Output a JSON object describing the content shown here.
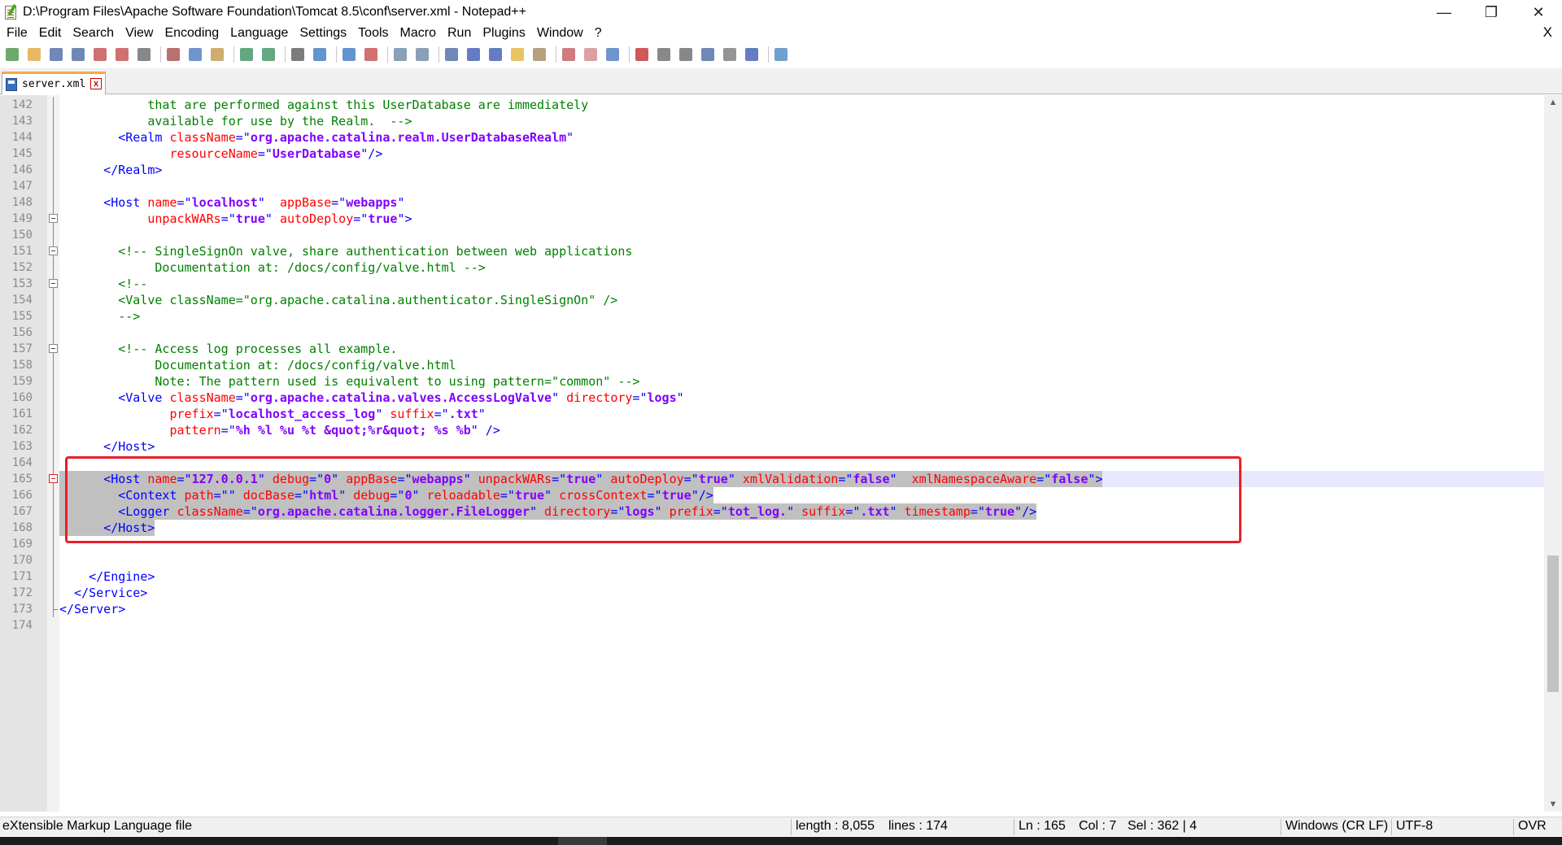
{
  "window": {
    "title": "D:\\Program Files\\Apache Software Foundation\\Tomcat 8.5\\conf\\server.xml - Notepad++",
    "minimize_glyph": "—",
    "restore_glyph": "❐",
    "close_glyph": "✕"
  },
  "menu": {
    "items": [
      "File",
      "Edit",
      "Search",
      "View",
      "Encoding",
      "Language",
      "Settings",
      "Tools",
      "Macro",
      "Run",
      "Plugins",
      "Window",
      "?"
    ],
    "close_glyph": "X"
  },
  "toolbar": {
    "icons": [
      "new-file-icon",
      "open-file-icon",
      "save-icon",
      "save-all-icon",
      "close-icon",
      "close-all-icon",
      "print-icon",
      "cut-icon",
      "copy-icon",
      "paste-icon",
      "undo-icon",
      "redo-icon",
      "find-icon",
      "replace-icon",
      "zoom-in-icon",
      "zoom-out-icon",
      "sync-vertical-icon",
      "sync-horizontal-icon",
      "word-wrap-icon",
      "show-all-chars-icon",
      "indent-guide-icon",
      "user-lang-icon",
      "doc-map-icon",
      "function-list-icon",
      "folder-workspace-icon",
      "monitoring-icon",
      "record-macro-icon",
      "stop-macro-icon",
      "play-macro-icon",
      "run-macro-multiple-icon",
      "save-macro-icon",
      "spell-check-icon",
      "spell-next-icon"
    ],
    "colors": [
      "#3c8c3c",
      "#e0a030",
      "#4060a0",
      "#4060a0",
      "#c04040",
      "#c04040",
      "#606060",
      "#a04040",
      "#4070c0",
      "#c09040",
      "#2e8b57",
      "#2e8b57",
      "#505050",
      "#3070c0",
      "#3070c0",
      "#c04040",
      "#6080a0",
      "#6080a0",
      "#4060a0",
      "#3050b0",
      "#3050b0",
      "#e0b030",
      "#a08050",
      "#c05050",
      "#d08080",
      "#4070c0",
      "#c02020",
      "#606060",
      "#606060",
      "#4060a0",
      "#707070",
      "#3050b0",
      "#4080c0"
    ]
  },
  "tab": {
    "label": "server.xml"
  },
  "editor": {
    "selected_lines": [
      165,
      166,
      167,
      168
    ],
    "current_line": 165,
    "lines": [
      {
        "n": "142",
        "seg": [
          [
            "com",
            "            that are performed against this UserDatabase are immediately"
          ]
        ]
      },
      {
        "n": "143",
        "seg": [
          [
            "com",
            "            available for use by the Realm.  -->"
          ]
        ]
      },
      {
        "n": "144",
        "seg": [
          [
            "tag",
            "        <Realm "
          ],
          [
            "attr",
            "className"
          ],
          [
            "tag",
            "=\""
          ],
          [
            "val",
            "org.apache.catalina.realm.UserDatabaseRealm"
          ],
          [
            "tag",
            "\""
          ]
        ]
      },
      {
        "n": "145",
        "seg": [
          [
            "plain",
            "               "
          ],
          [
            "attr",
            "resourceName"
          ],
          [
            "tag",
            "=\""
          ],
          [
            "val",
            "UserDatabase"
          ],
          [
            "tag",
            "\"/>"
          ]
        ]
      },
      {
        "n": "146",
        "seg": [
          [
            "tag",
            "      </Realm>"
          ]
        ]
      },
      {
        "n": "147",
        "seg": []
      },
      {
        "n": "148",
        "seg": [
          [
            "tag",
            "      <Host "
          ],
          [
            "attr",
            "name"
          ],
          [
            "tag",
            "=\""
          ],
          [
            "val",
            "localhost"
          ],
          [
            "tag",
            "\"  "
          ],
          [
            "attr",
            "appBase"
          ],
          [
            "tag",
            "=\""
          ],
          [
            "val",
            "webapps"
          ],
          [
            "tag",
            "\""
          ]
        ]
      },
      {
        "n": "149",
        "seg": [
          [
            "plain",
            "            "
          ],
          [
            "attr",
            "unpackWARs"
          ],
          [
            "tag",
            "=\""
          ],
          [
            "val",
            "true"
          ],
          [
            "tag",
            "\" "
          ],
          [
            "attr",
            "autoDeploy"
          ],
          [
            "tag",
            "=\""
          ],
          [
            "val",
            "true"
          ],
          [
            "tag",
            "\">"
          ]
        ]
      },
      {
        "n": "150",
        "seg": []
      },
      {
        "n": "151",
        "seg": [
          [
            "com",
            "        <!-- SingleSignOn valve, share authentication between web applications"
          ]
        ]
      },
      {
        "n": "152",
        "seg": [
          [
            "com",
            "             Documentation at: /docs/config/valve.html -->"
          ]
        ]
      },
      {
        "n": "153",
        "seg": [
          [
            "com",
            "        <!--"
          ]
        ]
      },
      {
        "n": "154",
        "seg": [
          [
            "com",
            "        <Valve className=\"org.apache.catalina.authenticator.SingleSignOn\" />"
          ]
        ]
      },
      {
        "n": "155",
        "seg": [
          [
            "com",
            "        -->"
          ]
        ]
      },
      {
        "n": "156",
        "seg": []
      },
      {
        "n": "157",
        "seg": [
          [
            "com",
            "        <!-- Access log processes all example."
          ]
        ]
      },
      {
        "n": "158",
        "seg": [
          [
            "com",
            "             Documentation at: /docs/config/valve.html"
          ]
        ]
      },
      {
        "n": "159",
        "seg": [
          [
            "com",
            "             Note: The pattern used is equivalent to using pattern=\"common\" -->"
          ]
        ]
      },
      {
        "n": "160",
        "seg": [
          [
            "tag",
            "        <Valve "
          ],
          [
            "attr",
            "className"
          ],
          [
            "tag",
            "=\""
          ],
          [
            "val",
            "org.apache.catalina.valves.AccessLogValve"
          ],
          [
            "tag",
            "\" "
          ],
          [
            "attr",
            "directory"
          ],
          [
            "tag",
            "=\""
          ],
          [
            "val",
            "logs"
          ],
          [
            "tag",
            "\""
          ]
        ]
      },
      {
        "n": "161",
        "seg": [
          [
            "plain",
            "               "
          ],
          [
            "attr",
            "prefix"
          ],
          [
            "tag",
            "=\""
          ],
          [
            "val",
            "localhost_access_log"
          ],
          [
            "tag",
            "\" "
          ],
          [
            "attr",
            "suffix"
          ],
          [
            "tag",
            "=\""
          ],
          [
            "val",
            ".txt"
          ],
          [
            "tag",
            "\""
          ]
        ]
      },
      {
        "n": "162",
        "seg": [
          [
            "plain",
            "               "
          ],
          [
            "attr",
            "pattern"
          ],
          [
            "tag",
            "=\""
          ],
          [
            "val",
            "%h %l %u %t &quot;%r&quot; %s %b"
          ],
          [
            "tag",
            "\" />"
          ]
        ]
      },
      {
        "n": "163",
        "seg": [
          [
            "tag",
            "      </Host>"
          ]
        ]
      },
      {
        "n": "164",
        "seg": []
      },
      {
        "n": "165",
        "seg": [
          [
            "plain",
            "      "
          ],
          [
            "tag",
            "<Host "
          ],
          [
            "attr",
            "name"
          ],
          [
            "tag",
            "=\""
          ],
          [
            "val",
            "127.0.0.1"
          ],
          [
            "tag",
            "\" "
          ],
          [
            "attr",
            "debug"
          ],
          [
            "tag",
            "=\""
          ],
          [
            "val",
            "0"
          ],
          [
            "tag",
            "\" "
          ],
          [
            "attr",
            "appBase"
          ],
          [
            "tag",
            "=\""
          ],
          [
            "val",
            "webapps"
          ],
          [
            "tag",
            "\" "
          ],
          [
            "attr",
            "unpackWARs"
          ],
          [
            "tag",
            "=\""
          ],
          [
            "val",
            "true"
          ],
          [
            "tag",
            "\" "
          ],
          [
            "attr",
            "autoDeploy"
          ],
          [
            "tag",
            "=\""
          ],
          [
            "val",
            "true"
          ],
          [
            "tag",
            "\" "
          ],
          [
            "attr",
            "xmlValidation"
          ],
          [
            "tag",
            "=\""
          ],
          [
            "val",
            "false"
          ],
          [
            "tag",
            "\"  "
          ],
          [
            "attr",
            "xmlNamespaceAware"
          ],
          [
            "tag",
            "=\""
          ],
          [
            "val",
            "false"
          ],
          [
            "tag",
            "\">"
          ]
        ]
      },
      {
        "n": "166",
        "seg": [
          [
            "plain",
            "        "
          ],
          [
            "tag",
            "<Context "
          ],
          [
            "attr",
            "path"
          ],
          [
            "tag",
            "=\"\" "
          ],
          [
            "attr",
            "docBase"
          ],
          [
            "tag",
            "=\""
          ],
          [
            "val",
            "html"
          ],
          [
            "tag",
            "\" "
          ],
          [
            "attr",
            "debug"
          ],
          [
            "tag",
            "=\""
          ],
          [
            "val",
            "0"
          ],
          [
            "tag",
            "\" "
          ],
          [
            "attr",
            "reloadable"
          ],
          [
            "tag",
            "=\""
          ],
          [
            "val",
            "true"
          ],
          [
            "tag",
            "\" "
          ],
          [
            "attr",
            "crossContext"
          ],
          [
            "tag",
            "=\""
          ],
          [
            "val",
            "true"
          ],
          [
            "tag",
            "\"/>"
          ]
        ]
      },
      {
        "n": "167",
        "seg": [
          [
            "plain",
            "        "
          ],
          [
            "tag",
            "<Logger "
          ],
          [
            "attr",
            "className"
          ],
          [
            "tag",
            "=\""
          ],
          [
            "val",
            "org.apache.catalina.logger.FileLogger"
          ],
          [
            "tag",
            "\" "
          ],
          [
            "attr",
            "directory"
          ],
          [
            "tag",
            "=\""
          ],
          [
            "val",
            "logs"
          ],
          [
            "tag",
            "\" "
          ],
          [
            "attr",
            "prefix"
          ],
          [
            "tag",
            "=\""
          ],
          [
            "val",
            "tot_log."
          ],
          [
            "tag",
            "\" "
          ],
          [
            "attr",
            "suffix"
          ],
          [
            "tag",
            "=\""
          ],
          [
            "val",
            ".txt"
          ],
          [
            "tag",
            "\" "
          ],
          [
            "attr",
            "timestamp"
          ],
          [
            "tag",
            "=\""
          ],
          [
            "val",
            "true"
          ],
          [
            "tag",
            "\"/>"
          ]
        ]
      },
      {
        "n": "168",
        "seg": [
          [
            "plain",
            "      "
          ],
          [
            "tag",
            "</Host>"
          ]
        ]
      },
      {
        "n": "169",
        "seg": []
      },
      {
        "n": "170",
        "seg": []
      },
      {
        "n": "171",
        "seg": [
          [
            "tag",
            "    </Engine>"
          ]
        ]
      },
      {
        "n": "172",
        "seg": [
          [
            "tag",
            "  </Service>"
          ]
        ]
      },
      {
        "n": "173",
        "seg": [
          [
            "tag",
            "</Server>"
          ]
        ]
      },
      {
        "n": "174",
        "seg": []
      }
    ]
  },
  "status": {
    "file_type": "eXtensible Markup Language file",
    "length": "length : 8,055",
    "lines": "lines : 174",
    "ln": "Ln : 165",
    "col": "Col : 7",
    "sel": "Sel : 362 | 4",
    "eol": "Windows (CR LF)",
    "encoding": "UTF-8",
    "mode": "OVR"
  }
}
